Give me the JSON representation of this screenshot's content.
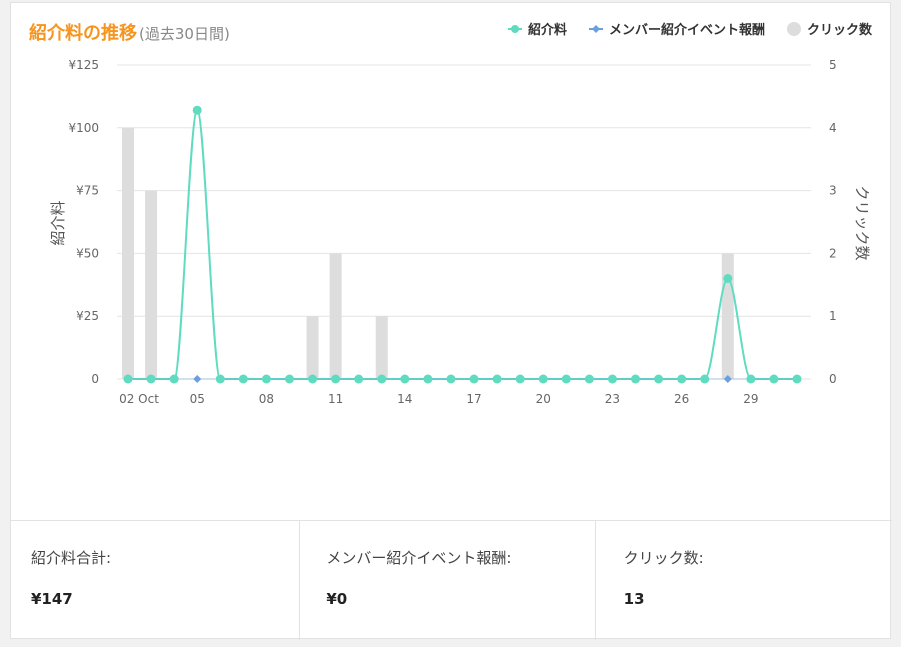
{
  "title": {
    "main": "紹介料の推移",
    "sub": "(過去30日間)"
  },
  "legend": [
    {
      "label": "紹介料",
      "color": "#5fdcc0",
      "shape": "circle"
    },
    {
      "label": "メンバー紹介イベント報酬",
      "color": "#6a9fe0",
      "shape": "diamond"
    },
    {
      "label": "クリック数",
      "color": "#dddddd",
      "shape": "circle"
    }
  ],
  "chart_data": {
    "type": "line+bar",
    "y_left": {
      "label": "紹介料",
      "min": 0,
      "max": 125,
      "ticks": [
        "¥125",
        "¥100",
        "¥75",
        "¥50",
        "¥25",
        "0"
      ]
    },
    "y_right": {
      "label": "クリック数",
      "min": 0,
      "max": 5,
      "ticks": [
        "5",
        "4",
        "3",
        "2",
        "1",
        "0"
      ]
    },
    "x_tick_labels": [
      "02 Oct",
      "05",
      "08",
      "11",
      "14",
      "17",
      "20",
      "23",
      "26",
      "29"
    ],
    "x_tick_index": [
      0,
      3,
      6,
      9,
      12,
      15,
      18,
      21,
      24,
      27
    ],
    "days": 30,
    "grid": true,
    "series": [
      {
        "name": "紹介料",
        "kind": "line",
        "axis": "left",
        "values": [
          0,
          0,
          0,
          107,
          0,
          0,
          0,
          0,
          0,
          0,
          0,
          0,
          0,
          0,
          0,
          0,
          0,
          0,
          0,
          0,
          0,
          0,
          0,
          0,
          0,
          0,
          40,
          0,
          0,
          0
        ]
      },
      {
        "name": "メンバー紹介イベント報酬",
        "kind": "line-markers",
        "axis": "left",
        "values": [
          0,
          0,
          0,
          0,
          0,
          0,
          0,
          0,
          0,
          0,
          0,
          0,
          0,
          0,
          0,
          0,
          0,
          0,
          0,
          0,
          0,
          0,
          0,
          0,
          0,
          0,
          0,
          0,
          0,
          0
        ],
        "marker_index": [
          3,
          26
        ]
      },
      {
        "name": "クリック数",
        "kind": "bar",
        "axis": "right",
        "values": [
          4,
          3,
          0,
          0,
          0,
          0,
          0,
          0,
          1,
          2,
          0,
          1,
          0,
          0,
          0,
          0,
          0,
          0,
          0,
          0,
          0,
          0,
          0,
          0,
          0,
          0,
          2,
          0,
          0,
          0
        ]
      }
    ]
  },
  "stats": [
    {
      "label": "紹介料合計:",
      "value": "¥147"
    },
    {
      "label": "メンバー紹介イベント報酬:",
      "value": "¥0"
    },
    {
      "label": "クリック数:",
      "value": "13"
    }
  ]
}
